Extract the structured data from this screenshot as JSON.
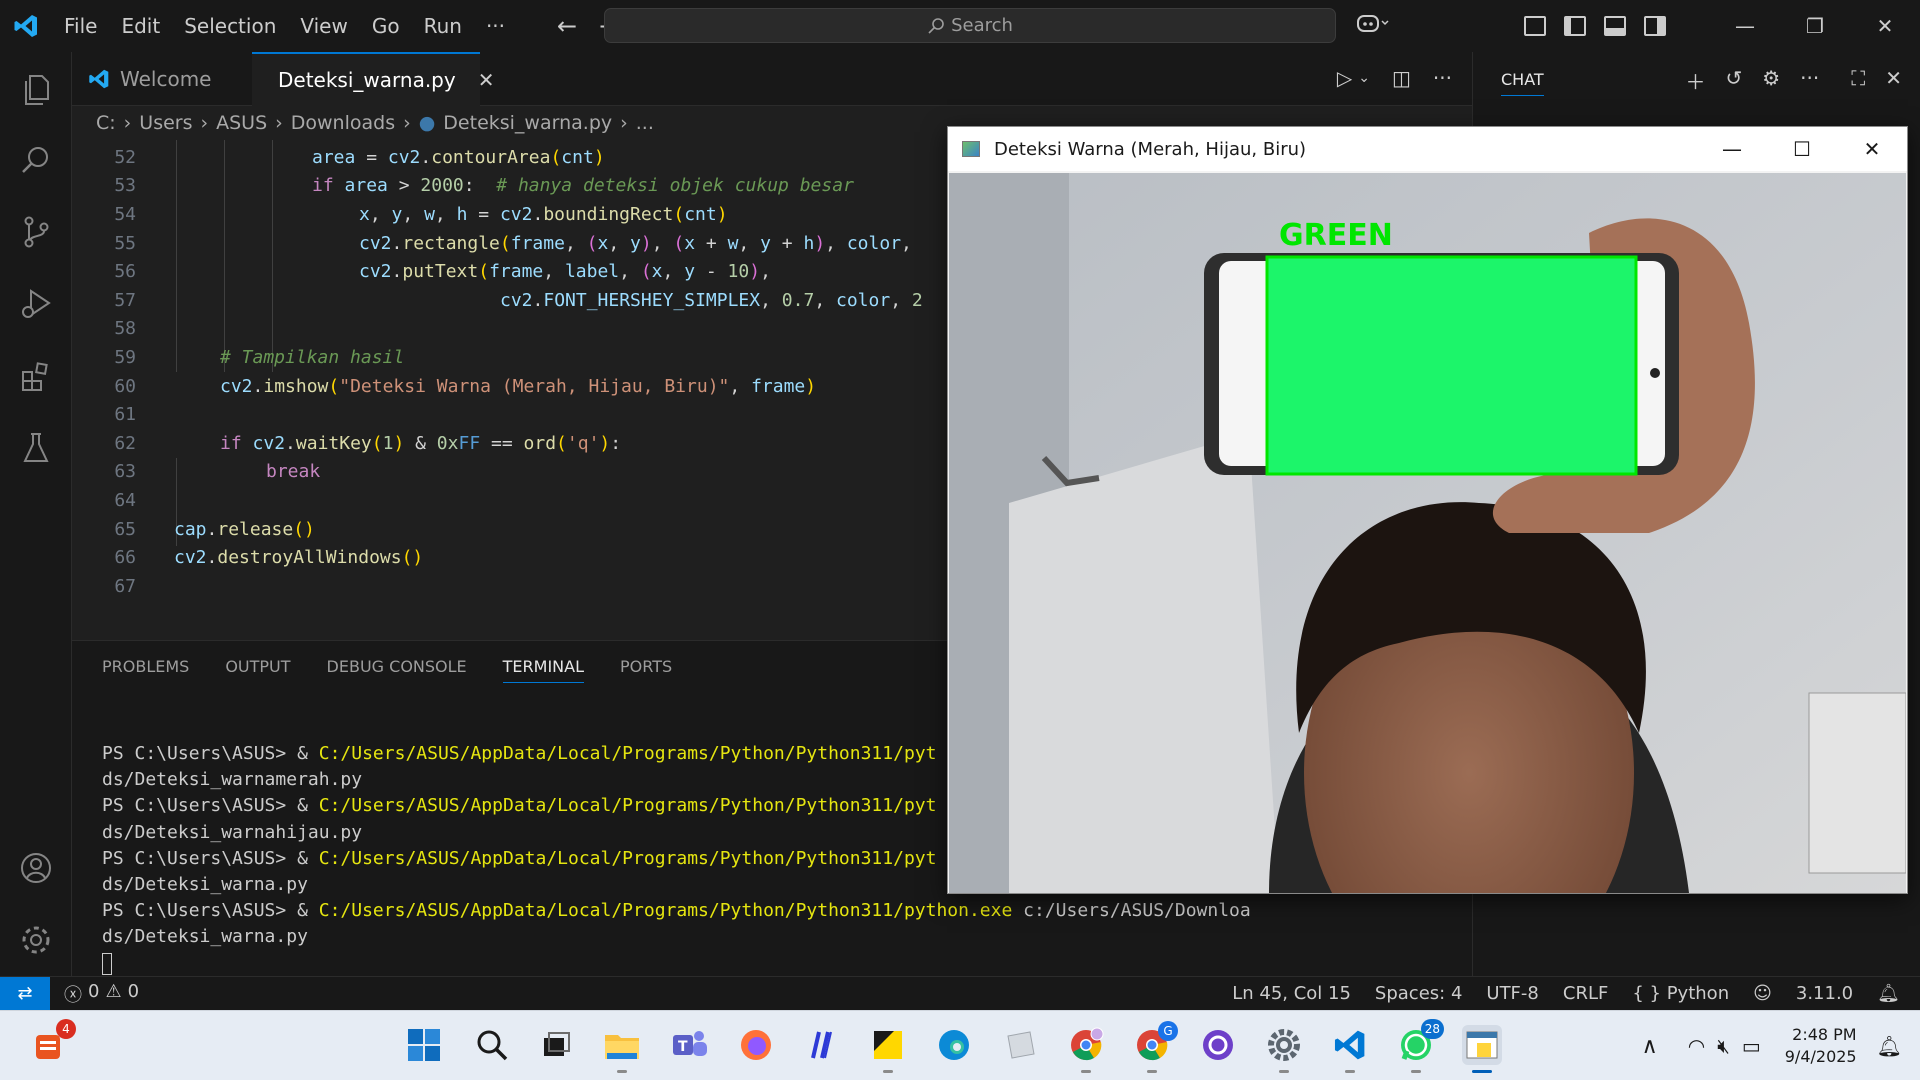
{
  "menu": [
    "File",
    "Edit",
    "Selection",
    "View",
    "Go",
    "Run",
    "···"
  ],
  "search_placeholder": "Search",
  "tabs": [
    {
      "label": "Welcome"
    },
    {
      "label": "Deteksi_warna.py"
    }
  ],
  "breadcrumb": [
    "C:",
    "Users",
    "ASUS",
    "Downloads",
    "Deteksi_warna.py",
    "..."
  ],
  "code_lines": [
    "52",
    "53",
    "54",
    "55",
    "56",
    "57",
    "58",
    "59",
    "60",
    "61",
    "62",
    "63",
    "64",
    "65",
    "66",
    "67"
  ],
  "panel_tabs": [
    "PROBLEMS",
    "OUTPUT",
    "DEBUG CONSOLE",
    "TERMINAL",
    "PORTS"
  ],
  "terminal": {
    "prompt": "PS C:\\Users\\ASUS> & ",
    "exe1": "C:/Users/ASUS/AppData/Local/Programs/Python/Python311/pyt",
    "exe_full": "C:/Users/ASUS/AppData/Local/Programs/Python/Python311/python.exe",
    "arg_full": " c:/Users/ASUS/Downloa",
    "l2": "ds/Deteksi_warnamerah.py",
    "l4": "ds/Deteksi_warnahijau.py",
    "l6": "ds/Deteksi_warna.py",
    "l8": "ds/Deteksi_warna.py"
  },
  "chat_title": "CHAT",
  "status": {
    "errors": "0",
    "warnings": "0",
    "position": "Ln 45, Col 15",
    "spaces": "Spaces: 4",
    "encoding": "UTF-8",
    "eol": "CRLF",
    "language": "Python",
    "version": "3.11.0"
  },
  "cv_window": {
    "title": "Deteksi Warna (Merah, Hijau, Biru)",
    "label": "GREEN",
    "box_color": "#00e600",
    "fill_color": "#1cf56a"
  },
  "taskbar": {
    "badge_left": "4",
    "badge_whatsapp": "28",
    "badge_chrome2": "G",
    "time": "2:48 PM",
    "date": "9/4/2025"
  },
  "colors": {
    "accent": "#0078d4",
    "editor_bg": "#1f1f1f"
  }
}
